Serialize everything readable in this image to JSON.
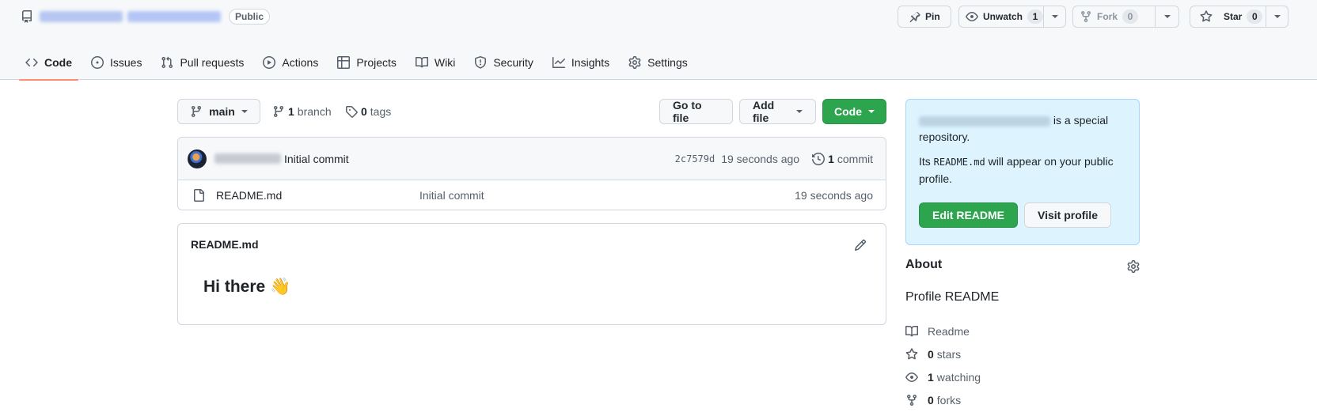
{
  "header": {
    "visibility_badge": "Public",
    "pin_label": "Pin",
    "unwatch_label": "Unwatch",
    "unwatch_count": "1",
    "fork_label": "Fork",
    "fork_count": "0",
    "star_label": "Star",
    "star_count": "0"
  },
  "nav": {
    "tabs": [
      {
        "label": "Code",
        "icon": "code-icon",
        "active": true
      },
      {
        "label": "Issues",
        "icon": "issue-icon"
      },
      {
        "label": "Pull requests",
        "icon": "pull-request-icon"
      },
      {
        "label": "Actions",
        "icon": "play-icon"
      },
      {
        "label": "Projects",
        "icon": "table-icon"
      },
      {
        "label": "Wiki",
        "icon": "book-icon"
      },
      {
        "label": "Security",
        "icon": "shield-icon"
      },
      {
        "label": "Insights",
        "icon": "graph-icon"
      },
      {
        "label": "Settings",
        "icon": "gear-icon"
      }
    ]
  },
  "toolbar": {
    "branch_name": "main",
    "branch_count": "1",
    "branch_word": "branch",
    "tag_count": "0",
    "tag_word": "tags",
    "go_to_file": "Go to file",
    "add_file": "Add file",
    "code": "Code"
  },
  "commit": {
    "message": "Initial commit",
    "sha": "2c7579d",
    "age": "19 seconds ago",
    "count": "1",
    "count_word": "commit"
  },
  "files": [
    {
      "name": "README.md",
      "message": "Initial commit",
      "age": "19 seconds ago"
    }
  ],
  "readme": {
    "title": "README.md",
    "heading": "Hi there",
    "emoji": "👋"
  },
  "special": {
    "line1_suffix": "is a special repository.",
    "line2_prefix": "Its",
    "line2_code": "README.md",
    "line2_suffix": "will appear on your public profile.",
    "edit_button": "Edit README",
    "visit_button": "Visit profile"
  },
  "about": {
    "title": "About",
    "description": "Profile README",
    "readme_label": "Readme",
    "stars_count": "0",
    "stars_word": "stars",
    "watching_count": "1",
    "watching_word": "watching",
    "forks_count": "0",
    "forks_word": "forks"
  },
  "colors": {
    "accent_green": "#2da44e",
    "active_tab_underline": "#fd8c73",
    "special_box_bg": "#ddf4ff"
  }
}
